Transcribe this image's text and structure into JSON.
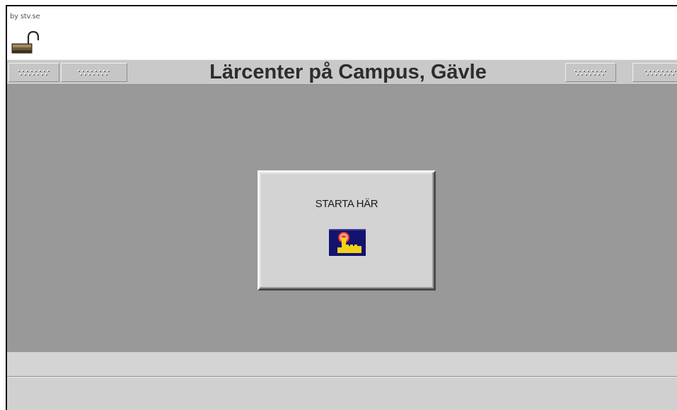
{
  "header": {
    "credit": "by stv.se",
    "title": "Lärcenter på Campus, Gävle"
  },
  "icons": {
    "lock": "unlocked-padlock-icon",
    "grip": "dotted-grip-icon",
    "start": "hand-pointer-icon"
  },
  "main": {
    "start_label": "STARTA HÄR"
  },
  "colors": {
    "main_background": "#999999",
    "header_bar": "#c9c9c9",
    "panel": "#d3d3d3",
    "start_icon_background": "#13136f",
    "start_icon_hand": "#f2d218",
    "start_icon_dot": "#e23b1c"
  }
}
